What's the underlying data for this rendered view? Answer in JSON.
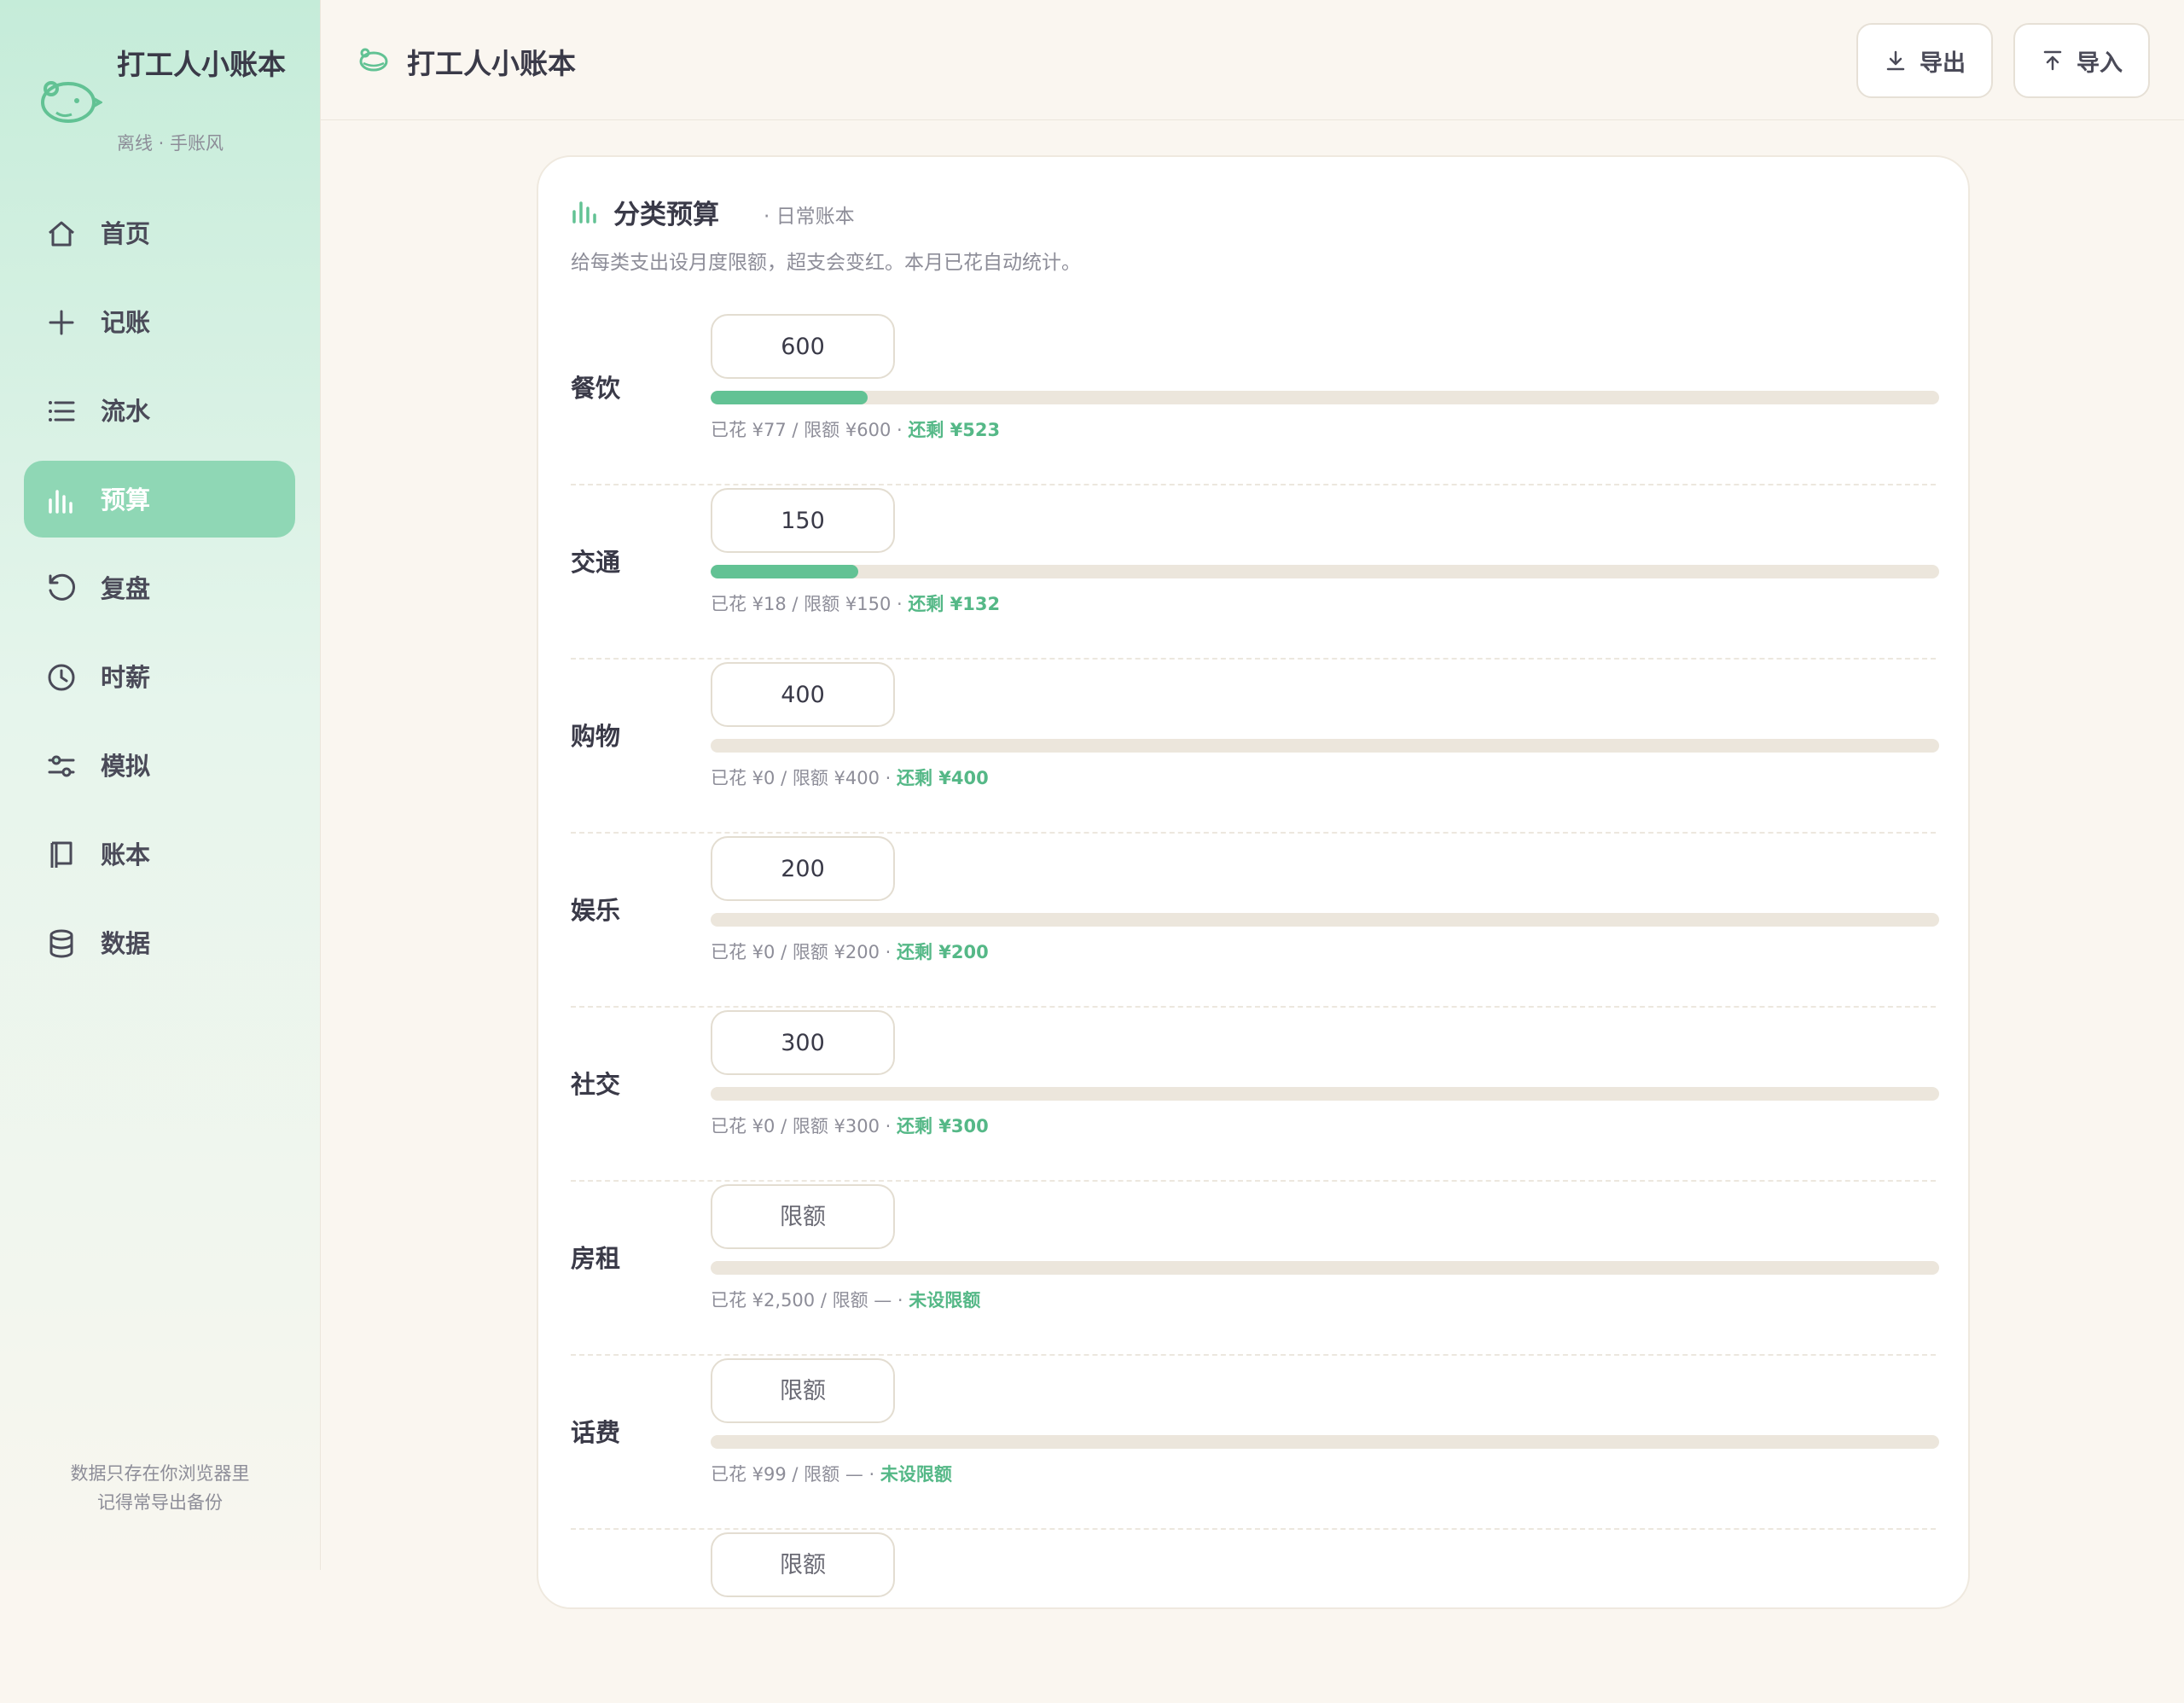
{
  "brand": {
    "title": "打工人小账本",
    "subtitle": "离线 · 手账风"
  },
  "nav": [
    {
      "label": "首页",
      "icon": "home-icon",
      "active": false
    },
    {
      "label": "记账",
      "icon": "plus-icon",
      "active": false
    },
    {
      "label": "流水",
      "icon": "list-icon",
      "active": false
    },
    {
      "label": "预算",
      "icon": "bar-chart-icon",
      "active": true
    },
    {
      "label": "复盘",
      "icon": "refresh-icon",
      "active": false
    },
    {
      "label": "时薪",
      "icon": "clock-icon",
      "active": false
    },
    {
      "label": "模拟",
      "icon": "sliders-icon",
      "active": false
    },
    {
      "label": "账本",
      "icon": "book-icon",
      "active": false
    },
    {
      "label": "数据",
      "icon": "database-icon",
      "active": false
    }
  ],
  "sidebar_footer": {
    "line1": "数据只存在你浏览器里",
    "line2": "记得常导出备份"
  },
  "header": {
    "title": "打工人小账本",
    "export_label": "导出",
    "import_label": "导入"
  },
  "card": {
    "title": "分类预算",
    "subtitle": "· 日常账本",
    "description": "给每类支出设月度限额，超支会变红。本月已花自动统计。"
  },
  "input_placeholder": "限额",
  "budgets": [
    {
      "category": "餐饮",
      "limit": "600",
      "spent_text": "已花 ¥77 / 限额 ¥600 · ",
      "remain_text": "还剩 ¥523",
      "progress": 0.128
    },
    {
      "category": "交通",
      "limit": "150",
      "spent_text": "已花 ¥18 / 限额 ¥150 · ",
      "remain_text": "还剩 ¥132",
      "progress": 0.12
    },
    {
      "category": "购物",
      "limit": "400",
      "spent_text": "已花 ¥0 / 限额 ¥400 · ",
      "remain_text": "还剩 ¥400",
      "progress": 0
    },
    {
      "category": "娱乐",
      "limit": "200",
      "spent_text": "已花 ¥0 / 限额 ¥200 · ",
      "remain_text": "还剩 ¥200",
      "progress": 0
    },
    {
      "category": "社交",
      "limit": "300",
      "spent_text": "已花 ¥0 / 限额 ¥300 · ",
      "remain_text": "还剩 ¥300",
      "progress": 0
    },
    {
      "category": "房租",
      "limit": "",
      "spent_text": "已花 ¥2,500 / 限额 — · ",
      "remain_text": "未设限额",
      "progress": 0
    },
    {
      "category": "话费",
      "limit": "",
      "spent_text": "已花 ¥99 / 限额 — · ",
      "remain_text": "未设限额",
      "progress": 0
    },
    {
      "category": "",
      "limit": "",
      "spent_text": "",
      "remain_text": "",
      "progress": 0
    }
  ],
  "colors": {
    "accent": "#62c294",
    "nav_active": "#8fd7b5",
    "remain_text": "#55b887",
    "bar_track": "#ece6dc"
  }
}
